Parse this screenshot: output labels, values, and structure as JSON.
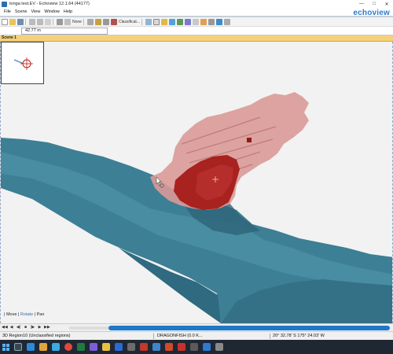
{
  "window": {
    "title": "tonga test.EV - Echoview 12.1.64 (44177)",
    "min_label": "—",
    "max_label": "□",
    "close_label": "✕"
  },
  "menu": {
    "items": [
      "File",
      "Scene",
      "View",
      "Window",
      "Help"
    ]
  },
  "brand": "echoview",
  "toolbar": {
    "none_label": "None",
    "classification_label": "Classificat..."
  },
  "location": {
    "depth_value": "42.77  m"
  },
  "scene": {
    "tab_label": "Scene 1"
  },
  "nav": {
    "move_label": "Move",
    "rotate_label": "Rotate",
    "pan_label": "Pan",
    "sep": "|"
  },
  "playback": {
    "buttons": [
      "◀◀",
      "◀",
      "◀|",
      "■",
      "|▶",
      "▶",
      "▶▶"
    ]
  },
  "status": {
    "region": "3D Region10 (Unclassified regions)",
    "file": "DRAGONFISH (0.0 K...",
    "coords": "20° 32.78' S 175° 24.03' W"
  },
  "colors": {
    "seafloor": "#3d7f95",
    "school": "#a8221f",
    "school_light": "#d99a98",
    "accent": "#2c7bd0",
    "taskbar": "#1f2733"
  },
  "icons": {
    "app": "echoview-app-icon",
    "target": "crosshair-target-icon"
  }
}
